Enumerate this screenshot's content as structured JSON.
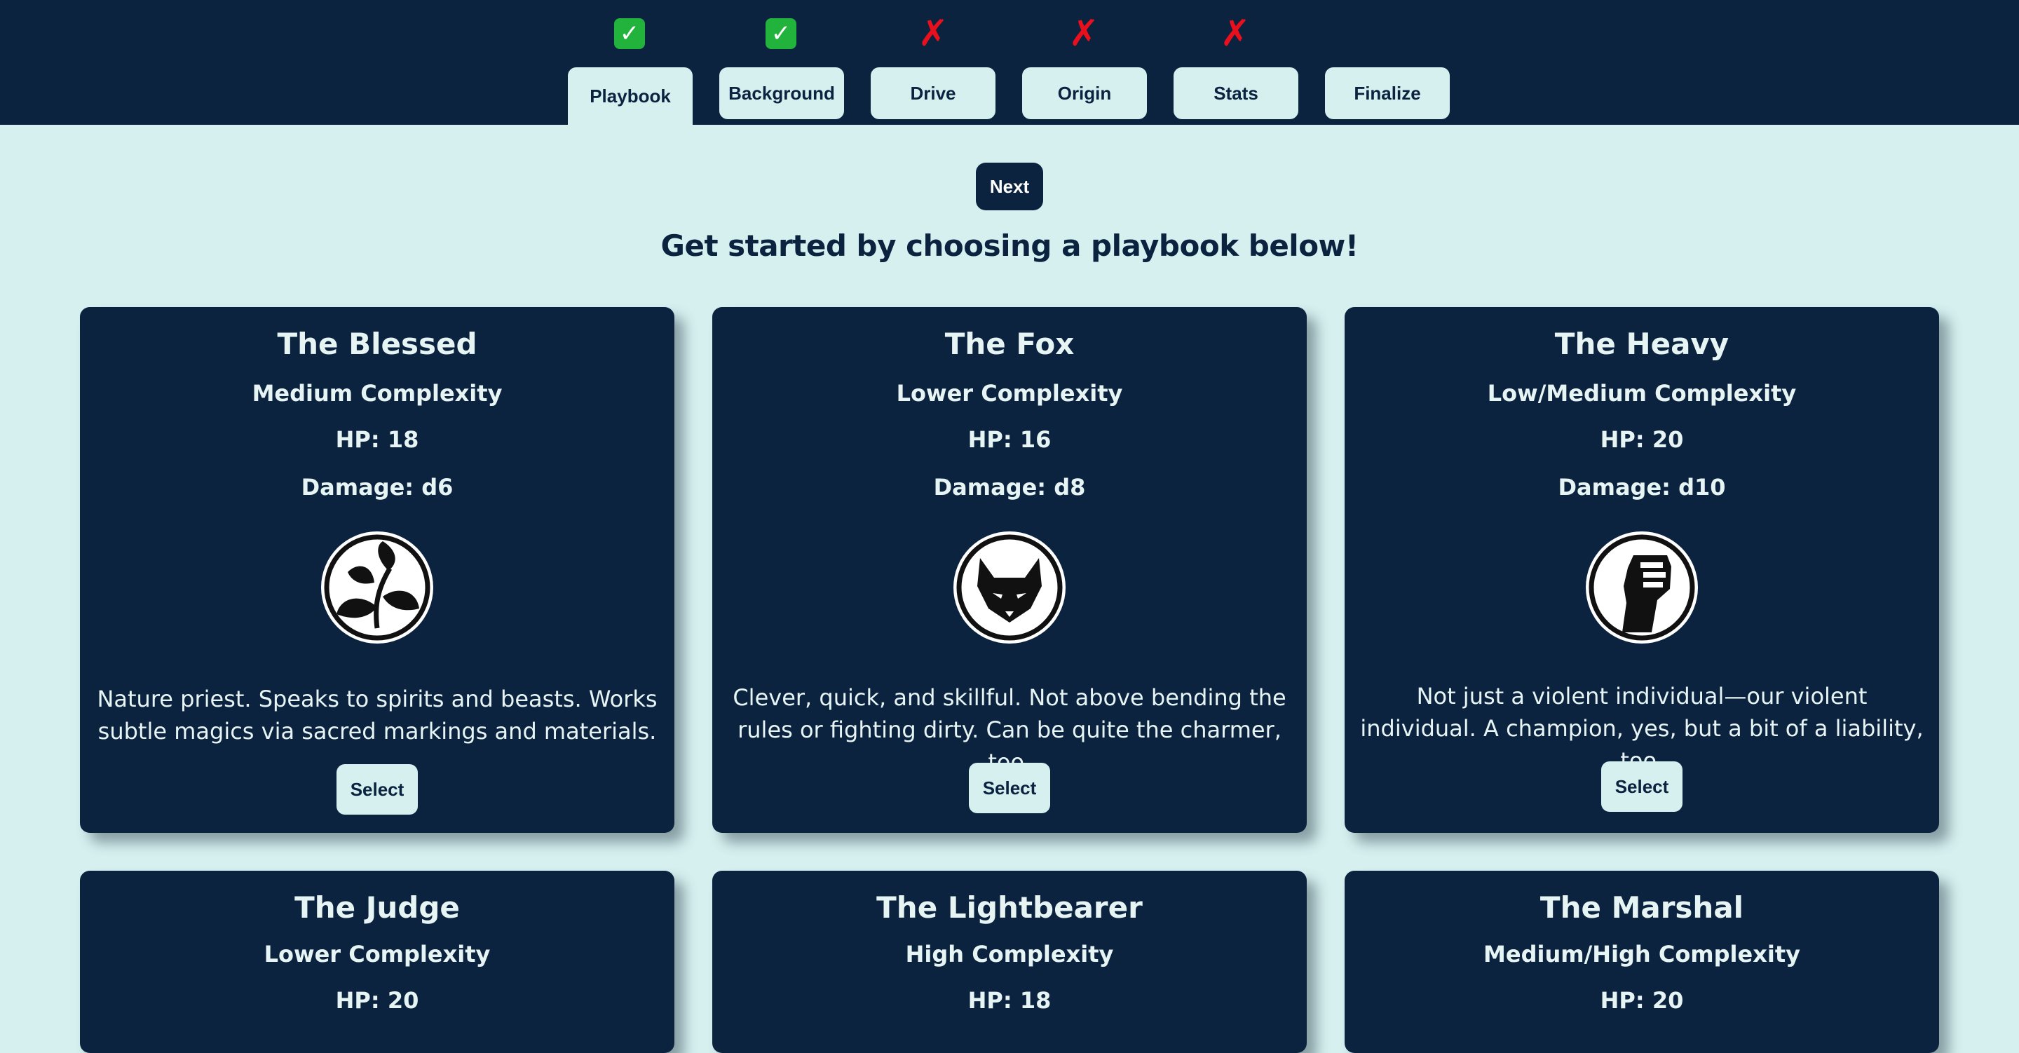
{
  "steps": [
    {
      "label": "Playbook",
      "status_icon": "check-mark-icon",
      "status_glyph": "✓",
      "done": true
    },
    {
      "label": "Background",
      "status_icon": "check-mark-icon",
      "status_glyph": "✓",
      "done": true
    },
    {
      "label": "Drive",
      "status_icon": "cross-mark-icon",
      "status_glyph": "✗",
      "done": false
    },
    {
      "label": "Origin",
      "status_icon": "cross-mark-icon",
      "status_glyph": "✗",
      "done": false
    },
    {
      "label": "Stats",
      "status_icon": "cross-mark-icon",
      "status_glyph": "✗",
      "done": false
    },
    {
      "label": "Finalize",
      "status_icon": "",
      "status_glyph": "",
      "done": false
    }
  ],
  "active_step": "Playbook",
  "next_label": "Next",
  "heading": "Get started by choosing a playbook below!",
  "playbooks": [
    {
      "name": "The Blessed",
      "complexity": "Medium Complexity",
      "hp": "HP: 18",
      "damage": "Damage: d6",
      "emblem": "sprout-leaves-icon",
      "description": "Nature priest. Speaks to spirits and beasts. Works subtle magics via sacred markings and materials.",
      "select_label": "Select"
    },
    {
      "name": "The Fox",
      "complexity": "Lower Complexity",
      "hp": "HP: 16",
      "damage": "Damage: d8",
      "emblem": "fox-head-icon",
      "description": "Clever, quick, and skillful. Not above bending the rules or fighting dirty. Can be quite the charmer, too.",
      "select_label": "Select"
    },
    {
      "name": "The Heavy",
      "complexity": "Low/Medium Complexity",
      "hp": "HP: 20",
      "damage": "Damage: d10",
      "emblem": "raised-fist-icon",
      "description": "Not just a violent individual—our violent individual. A champion, yes, but a bit of a liability, too.",
      "select_label": "Select"
    },
    {
      "name": "The Judge",
      "complexity": "Lower Complexity",
      "hp": "HP: 20"
    },
    {
      "name": "The Lightbearer",
      "complexity": "High Complexity",
      "hp": "HP: 18"
    },
    {
      "name": "The Marshal",
      "complexity": "Medium/High Complexity",
      "hp": "HP: 20"
    }
  ],
  "colors": {
    "navy": "#0c2340",
    "mint": "#d6f0f0",
    "check_green": "#22b33c",
    "cross_red": "#e8101c"
  }
}
